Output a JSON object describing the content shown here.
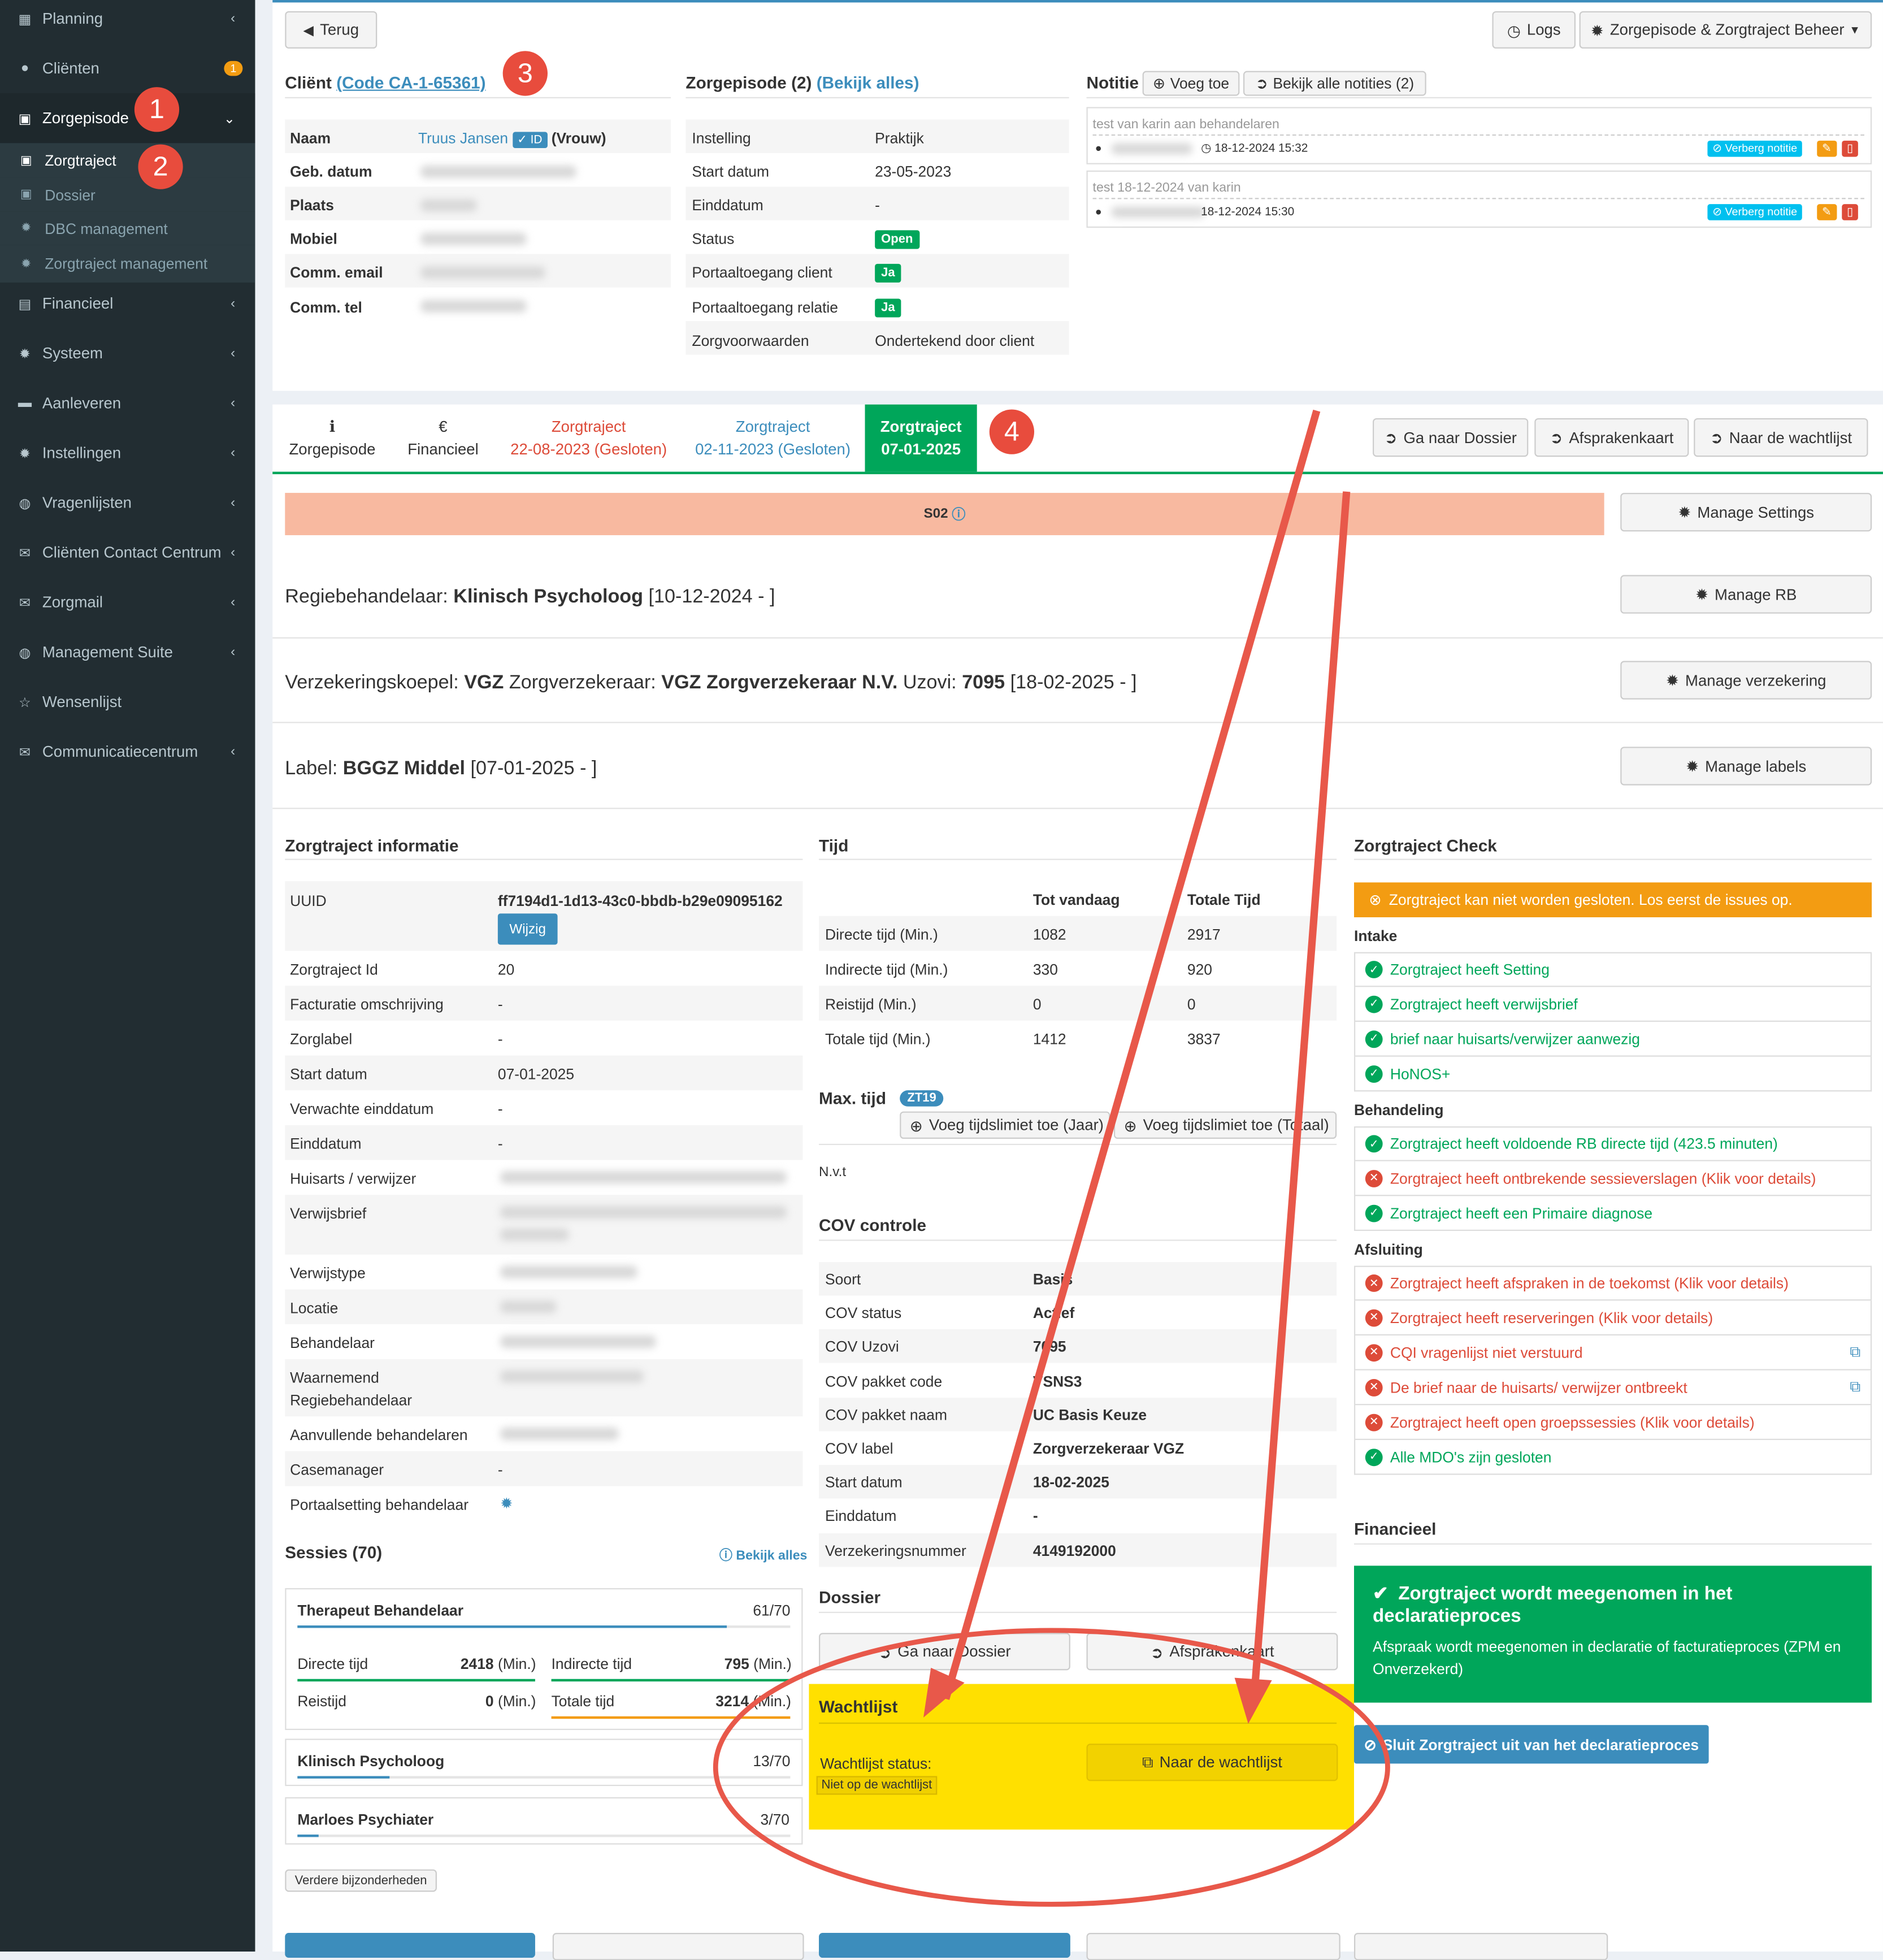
{
  "sidebar": {
    "items": [
      {
        "label": "Planning",
        "icon": "calendar-icon"
      },
      {
        "label": "Cliënten",
        "icon": "user-icon",
        "badge": "1"
      },
      {
        "label": "Zorgepisode",
        "icon": "briefcase-icon"
      },
      {
        "label": "Financieel",
        "icon": "book-icon"
      },
      {
        "label": "Systeem",
        "icon": "cogs-icon"
      },
      {
        "label": "Aanleveren",
        "icon": "truck-icon"
      },
      {
        "label": "Instellingen",
        "icon": "gear-icon"
      },
      {
        "label": "Vragenlijsten",
        "icon": "globe-icon"
      },
      {
        "label": "Cliënten Contact Centrum",
        "icon": "envelope-icon"
      },
      {
        "label": "Zorgmail",
        "icon": "envelope-icon"
      },
      {
        "label": "Management Suite",
        "icon": "globe-icon"
      },
      {
        "label": "Wensenlijst",
        "icon": "star-icon"
      },
      {
        "label": "Communicatiecentrum",
        "icon": "envelope-icon"
      }
    ],
    "subitems": [
      {
        "label": "Zorgtraject"
      },
      {
        "label": "Dossier"
      },
      {
        "label": "DBC management"
      },
      {
        "label": "Zorgtraject management"
      }
    ]
  },
  "annotations": [
    "1",
    "2",
    "3",
    "4"
  ],
  "toolbar": {
    "back": "Terug",
    "logs": "Logs",
    "beheer": "Zorgepisode & Zorgtraject Beheer"
  },
  "client": {
    "title": "Cliënt",
    "code": "(Code CA-1-65361)",
    "rows": [
      {
        "label": "Naam",
        "name": "Truus Jansen",
        "id_badge": "ID",
        "gender": "(Vrouw)"
      },
      {
        "label": "Geb. datum"
      },
      {
        "label": "Plaats"
      },
      {
        "label": "Mobiel"
      },
      {
        "label": "Comm. email"
      },
      {
        "label": "Comm. tel"
      }
    ]
  },
  "episode": {
    "title": "Zorgepisode (2)",
    "link": "(Bekijk alles)",
    "rows": [
      {
        "label": "Instelling",
        "value": "Praktijk"
      },
      {
        "label": "Start datum",
        "value": "23-05-2023"
      },
      {
        "label": "Einddatum",
        "value": "-"
      },
      {
        "label": "Status",
        "value": "Open"
      },
      {
        "label": "Portaaltoegang client",
        "value": "Ja"
      },
      {
        "label": "Portaaltoegang relatie",
        "value": "Ja"
      },
      {
        "label": "Zorgvoorwaarden",
        "value": "Ondertekend door client"
      }
    ]
  },
  "notes": {
    "title": "Notitie",
    "add": "Voeg toe",
    "all": "Bekijk alle notities (2)",
    "items": [
      {
        "text": "test van karin aan behandelaren",
        "date": "18-12-2024 15:32",
        "hide": "Verberg notitie"
      },
      {
        "text": "test 18-12-2024 van karin",
        "date": "18-12-2024 15:30",
        "hide": "Verberg notitie"
      }
    ]
  },
  "tabs": [
    {
      "line1": "Zorgepisode",
      "icon": "info-icon"
    },
    {
      "line1": "Financieel",
      "icon": "euro-icon"
    },
    {
      "line1": "Zorgtraject",
      "line2": "22-08-2023 (Gesloten)"
    },
    {
      "line1": "Zorgtraject",
      "line2": "02-11-2023 (Gesloten)"
    },
    {
      "line1": "Zorgtraject",
      "line2": "07-01-2025"
    }
  ],
  "tab_actions": {
    "dossier": "Ga naar Dossier",
    "afspraken": "Afsprakenkaart",
    "wachtlijst": "Naar de wachtlijst"
  },
  "setting_bar": {
    "label": "S02"
  },
  "manage": {
    "settings": "Manage Settings",
    "rb": "Manage RB",
    "verzekering": "Manage verzekering",
    "labels": "Manage labels"
  },
  "regie": {
    "prefix": "Regiebehandelaar:",
    "role": "Klinisch Psycholoog",
    "range": "[10-12-2024 - ]"
  },
  "verzekering": {
    "k_label": "Verzekeringskoepel:",
    "koepel": "VGZ",
    "z_label": "Zorgverzekeraar:",
    "verzekeraar": "VGZ Zorgverzekeraar N.V.",
    "u_label": "Uzovi:",
    "uzovi": "7095",
    "range": "[18-02-2025 - ]"
  },
  "label": {
    "prefix": "Label:",
    "value": "BGGZ Middel",
    "range": "[07-01-2025 - ]"
  },
  "info": {
    "title": "Zorgtraject informatie",
    "uuid_label": "UUID",
    "uuid": "ff7194d1-1d13-43c0-bbdb-b29e09095162",
    "wijzig": "Wijzig",
    "rows": [
      {
        "label": "Zorgtraject Id",
        "value": "20"
      },
      {
        "label": "Facturatie omschrijving",
        "value": "-"
      },
      {
        "label": "Zorglabel",
        "value": "-"
      },
      {
        "label": "Start datum",
        "value": "07-01-2025"
      },
      {
        "label": "Verwachte einddatum",
        "value": "-"
      },
      {
        "label": "Einddatum",
        "value": "-"
      },
      {
        "label": "Huisarts / verwijzer",
        "value": ""
      },
      {
        "label": "Verwijsbrief",
        "value": ""
      },
      {
        "label": "Verwijstype",
        "value": ""
      },
      {
        "label": "Locatie",
        "value": ""
      },
      {
        "label": "Behandelaar",
        "value": ""
      },
      {
        "label": "Waarnemend",
        "label2": "Regiebehandelaar",
        "value": ""
      },
      {
        "label": "Aanvullende behandelaren",
        "value": ""
      },
      {
        "label": "Casemanager",
        "value": "-"
      },
      {
        "label": "Portaalsetting behandelaar",
        "value": ""
      }
    ]
  },
  "sessies": {
    "title": "Sessies (70)",
    "link": "Bekijk alles",
    "cards": [
      {
        "name": "Therapeut Behandelaar",
        "count": "61/70",
        "progress": 0.871
      },
      {
        "name": "Klinisch Psycholoog",
        "count": "13/70",
        "progress": 0.186
      },
      {
        "name": "Marloes Psychiater",
        "count": "3/70",
        "progress": 0.043
      }
    ],
    "times": [
      {
        "label": "Directe tijd",
        "value": "2418",
        "unit": "(Min.)"
      },
      {
        "label": "Indirecte tijd",
        "value": "795",
        "unit": "(Min.)"
      },
      {
        "label": "Reistijd",
        "value": "0",
        "unit": "(Min.)"
      },
      {
        "label": "Totale tijd",
        "value": "3214",
        "unit": "(Min.)"
      }
    ],
    "details": "Verdere bijzonderheden"
  },
  "tijd": {
    "title": "Tijd",
    "col1": "Tot vandaag",
    "col2": "Totale Tijd",
    "rows": [
      {
        "label": "Directe tijd (Min.)",
        "a": "1082",
        "b": "2917"
      },
      {
        "label": "Indirecte tijd (Min.)",
        "a": "330",
        "b": "920"
      },
      {
        "label": "Reistijd (Min.)",
        "a": "0",
        "b": "0"
      },
      {
        "label": "Totale tijd (Min.)",
        "a": "1412",
        "b": "3837"
      }
    ],
    "max_title": "Max. tijd",
    "max_badge": "ZT19",
    "add_year": "Voeg tijdslimiet toe (Jaar)",
    "add_total": "Voeg tijdslimiet toe (Totaal)",
    "nvt": "N.v.t"
  },
  "cov": {
    "title": "COV controle",
    "rows": [
      {
        "label": "Soort",
        "value": "Basis"
      },
      {
        "label": "COV status",
        "value": "Actief"
      },
      {
        "label": "COV Uzovi",
        "value": "7095"
      },
      {
        "label": "COV pakket code",
        "value": "VSNS3"
      },
      {
        "label": "COV pakket naam",
        "value": "UC Basis Keuze"
      },
      {
        "label": "COV label",
        "value": "Zorgverzekeraar VGZ"
      },
      {
        "label": "Start datum",
        "value": "18-02-2025"
      },
      {
        "label": "Einddatum",
        "value": "-"
      },
      {
        "label": "Verzekeringsnummer",
        "value": "4149192000"
      }
    ]
  },
  "dossier": {
    "title": "Dossier",
    "btn1": "Ga naar Dossier",
    "btn2": "Afsprakenkaart"
  },
  "wachtlijst": {
    "title": "Wachtlijst",
    "status_label": "Wachtlijst status:",
    "status": "Niet op de wachtlijst",
    "btn": "Naar de wachtlijst"
  },
  "check": {
    "title": "Zorgtraject Check",
    "alert": "Zorgtraject kan niet worden gesloten. Los eerst de issues op.",
    "intake": "Intake",
    "behandeling": "Behandeling",
    "afsluiting": "Afsluiting",
    "intake_items": [
      {
        "text": "Zorgtraject heeft Setting",
        "ok": true
      },
      {
        "text": "Zorgtraject heeft verwijsbrief",
        "ok": true
      },
      {
        "text": "brief naar huisarts/verwijzer aanwezig",
        "ok": true
      },
      {
        "text": "HoNOS+",
        "ok": true
      }
    ],
    "behandeling_items": [
      {
        "text": "Zorgtraject heeft voldoende RB directe tijd (423.5 minuten)",
        "ok": true
      },
      {
        "text": "Zorgtraject heeft ontbrekende sessieverslagen (Klik voor details)",
        "ok": false
      },
      {
        "text": "Zorgtraject heeft een Primaire diagnose",
        "ok": true
      }
    ],
    "afsluiting_items": [
      {
        "text": "Zorgtraject heeft afspraken in de toekomst (Klik voor details)",
        "ok": false
      },
      {
        "text": "Zorgtraject heeft reserveringen (Klik voor details)",
        "ok": false
      },
      {
        "text": "CQI vragenlijst niet verstuurd",
        "ok": false
      },
      {
        "text": "De brief naar de huisarts/ verwijzer ontbreekt",
        "ok": false
      },
      {
        "text": "Zorgtraject heeft open groepssessies (Klik voor details)",
        "ok": false
      },
      {
        "text": "Alle MDO's zijn gesloten",
        "ok": true
      }
    ]
  },
  "financieel": {
    "title": "Financieel",
    "box_title": "Zorgtraject wordt meegenomen in het declaratieproces",
    "box_text": "Afspraak wordt meegenomen in declaratie of facturatieproces (ZPM en Onverzekerd)",
    "exclude": "Sluit Zorgtraject uit van het declaratieproces"
  },
  "colors": {
    "sidebar": "#222d32",
    "accent": "#3c8dbc",
    "success": "#00a65a",
    "danger": "#dd4b39",
    "warning": "#f39c12",
    "highlight": "#ffe000",
    "annotation": "#e84c3d"
  }
}
